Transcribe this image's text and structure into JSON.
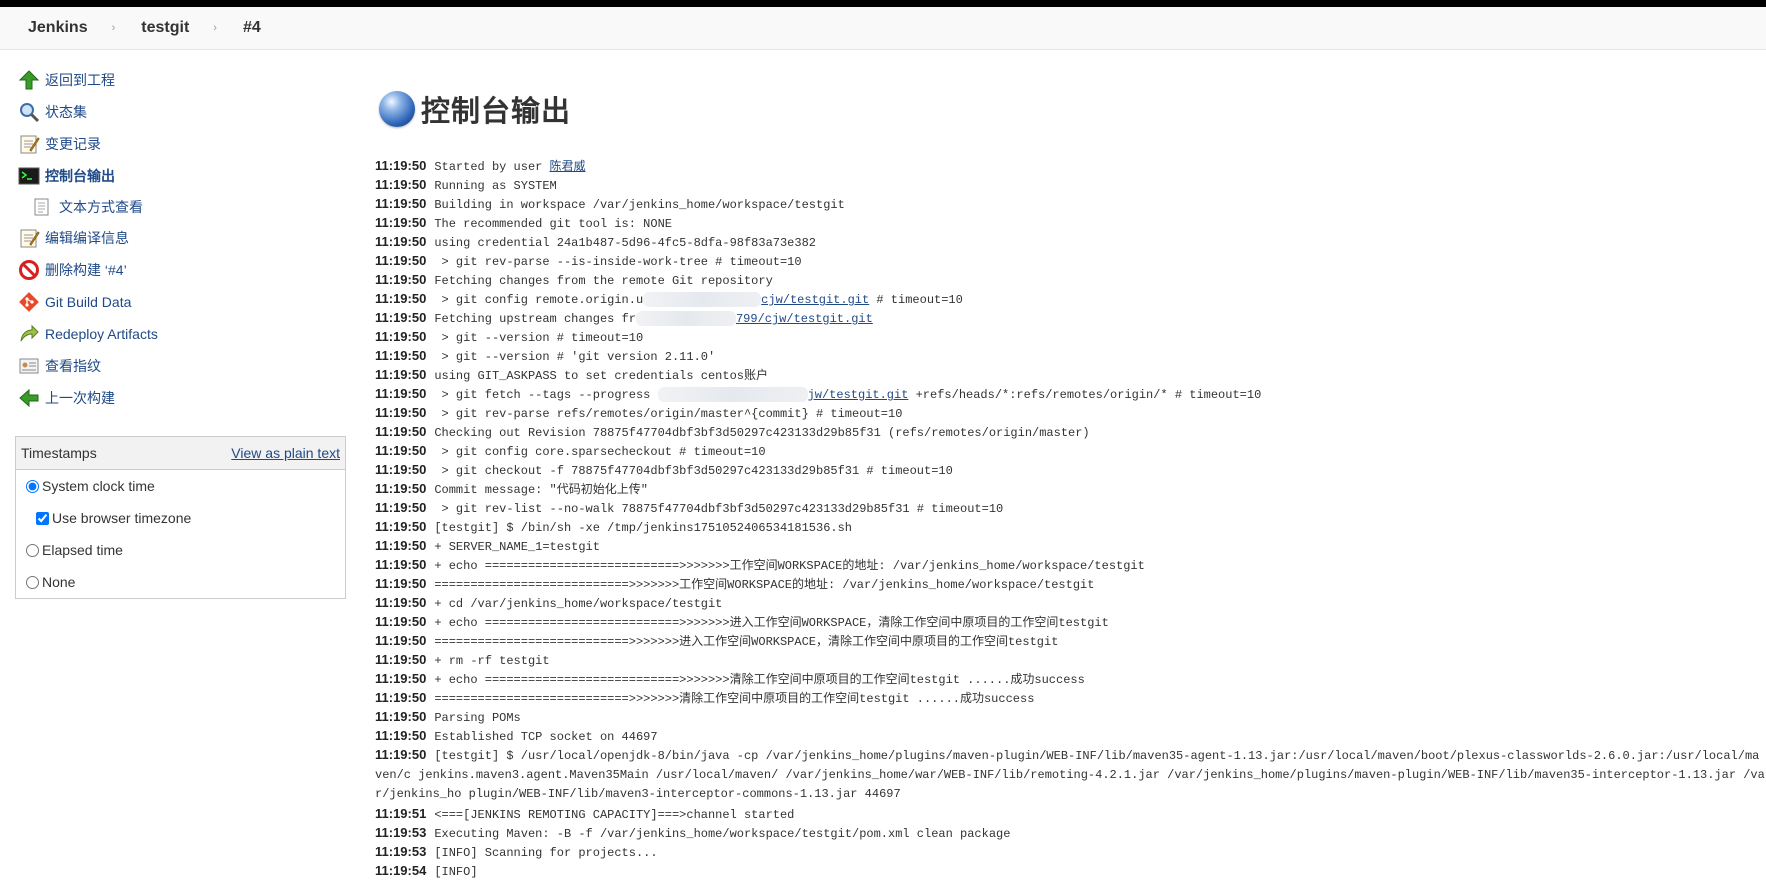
{
  "breadcrumb": [
    "Jenkins",
    "testgit",
    "#4"
  ],
  "sidebar": {
    "items": [
      {
        "label": "返回到工程",
        "icon": "up-arrow-icon"
      },
      {
        "label": "状态集",
        "icon": "magnifier-icon"
      },
      {
        "label": "变更记录",
        "icon": "notepad-icon"
      },
      {
        "label": "控制台输出",
        "icon": "terminal-icon"
      },
      {
        "label": "文本方式查看",
        "icon": "document-icon"
      },
      {
        "label": "编辑编译信息",
        "icon": "notepad-icon"
      },
      {
        "label": "删除构建 ‘#4’",
        "icon": "no-entry-icon"
      },
      {
        "label": "Git Build Data",
        "icon": "git-icon"
      },
      {
        "label": "Redeploy Artifacts",
        "icon": "redeploy-icon"
      },
      {
        "label": "查看指纹",
        "icon": "fingerprint-icon"
      },
      {
        "label": "上一次构建",
        "icon": "left-arrow-icon"
      }
    ]
  },
  "timestamps": {
    "title": "Timestamps",
    "plain_text_link": "View as plain text",
    "options": {
      "system": "System clock time",
      "browser_tz": "Use browser timezone",
      "elapsed": "Elapsed time",
      "none": "None"
    }
  },
  "page_title": "控制台输出",
  "console": [
    {
      "t": "11:19:50",
      "s": "Started by user ",
      "link": "陈君威"
    },
    {
      "t": "11:19:50",
      "s": "Running as SYSTEM"
    },
    {
      "t": "11:19:50",
      "s": "Building in workspace /var/jenkins_home/workspace/testgit"
    },
    {
      "t": "11:19:50",
      "s": "The recommended git tool is: NONE"
    },
    {
      "t": "11:19:50",
      "s": "using credential 24a1b487-5d96-4fc5-8dfa-98f83a73e382"
    },
    {
      "t": "11:19:50",
      "s": " > git rev-parse --is-inside-work-tree # timeout=10"
    },
    {
      "t": "11:19:50",
      "s": "Fetching changes from the remote Git repository"
    },
    {
      "t": "11:19:50",
      "s": " > git config remote.origin.u",
      "link": "cjw/testgit.git",
      "after": " # timeout=10"
    },
    {
      "t": "11:19:50",
      "s": "Fetching upstream changes fr",
      "link": "799/cjw/testgit.git"
    },
    {
      "t": "11:19:50",
      "s": " > git --version # timeout=10"
    },
    {
      "t": "11:19:50",
      "s": " > git --version # 'git version 2.11.0'"
    },
    {
      "t": "11:19:50",
      "s": "using GIT_ASKPASS to set credentials centos账户"
    },
    {
      "t": "11:19:50",
      "s": " > git fetch --tags --progress ",
      "link": "jw/testgit.git",
      "after": " +refs/heads/*:refs/remotes/origin/* # timeout=10"
    },
    {
      "t": "11:19:50",
      "s": " > git rev-parse refs/remotes/origin/master^{commit} # timeout=10"
    },
    {
      "t": "11:19:50",
      "s": "Checking out Revision 78875f47704dbf3bf3d50297c423133d29b85f31 (refs/remotes/origin/master)"
    },
    {
      "t": "11:19:50",
      "s": " > git config core.sparsecheckout # timeout=10"
    },
    {
      "t": "11:19:50",
      "s": " > git checkout -f 78875f47704dbf3bf3d50297c423133d29b85f31 # timeout=10"
    },
    {
      "t": "11:19:50",
      "s": "Commit message: \"代码初始化上传\""
    },
    {
      "t": "11:19:50",
      "s": " > git rev-list --no-walk 78875f47704dbf3bf3d50297c423133d29b85f31 # timeout=10"
    },
    {
      "t": "11:19:50",
      "s": "[testgit] $ /bin/sh -xe /tmp/jenkins1751052406534181536.sh"
    },
    {
      "t": "11:19:50",
      "s": "+ SERVER_NAME_1=testgit"
    },
    {
      "t": "11:19:50",
      "s": "+ echo ===========================>>>>>>>工作空间WORKSPACE的地址: /var/jenkins_home/workspace/testgit"
    },
    {
      "t": "11:19:50",
      "s": "===========================>>>>>>>工作空间WORKSPACE的地址: /var/jenkins_home/workspace/testgit"
    },
    {
      "t": "11:19:50",
      "s": "+ cd /var/jenkins_home/workspace/testgit"
    },
    {
      "t": "11:19:50",
      "s": "+ echo ===========================>>>>>>>进入工作空间WORKSPACE，清除工作空间中原项目的工作空间testgit"
    },
    {
      "t": "11:19:50",
      "s": "===========================>>>>>>>进入工作空间WORKSPACE，清除工作空间中原项目的工作空间testgit"
    },
    {
      "t": "11:19:50",
      "s": "+ rm -rf testgit"
    },
    {
      "t": "11:19:50",
      "s": "+ echo ===========================>>>>>>>清除工作空间中原项目的工作空间testgit ......成功success"
    },
    {
      "t": "11:19:50",
      "s": "===========================>>>>>>>清除工作空间中原项目的工作空间testgit ......成功success"
    },
    {
      "t": "11:19:50",
      "s": "Parsing POMs"
    },
    {
      "t": "11:19:50",
      "s": "Established TCP socket on 44697"
    },
    {
      "t": "11:19:50",
      "s": "[testgit] $ /usr/local/openjdk-8/bin/java -cp /var/jenkins_home/plugins/maven-plugin/WEB-INF/lib/maven35-agent-1.13.jar:/usr/local/maven/boot/plexus-classworlds-2.6.0.jar:/usr/local/maven/c jenkins.maven3.agent.Maven35Main /usr/local/maven/ /var/jenkins_home/war/WEB-INF/lib/remoting-4.2.1.jar /var/jenkins_home/plugins/maven-plugin/WEB-INF/lib/maven35-interceptor-1.13.jar /var/jenkins_ho plugin/WEB-INF/lib/maven3-interceptor-commons-1.13.jar 44697",
      "wrap": true
    },
    {
      "t": "11:19:51",
      "s": "<===[JENKINS REMOTING CAPACITY]===>channel started"
    },
    {
      "t": "11:19:53",
      "s": "Executing Maven:  -B -f /var/jenkins_home/workspace/testgit/pom.xml clean package"
    },
    {
      "t": "11:19:53",
      "s": "[INFO] Scanning for projects..."
    },
    {
      "t": "11:19:54",
      "s": "[INFO]"
    }
  ]
}
